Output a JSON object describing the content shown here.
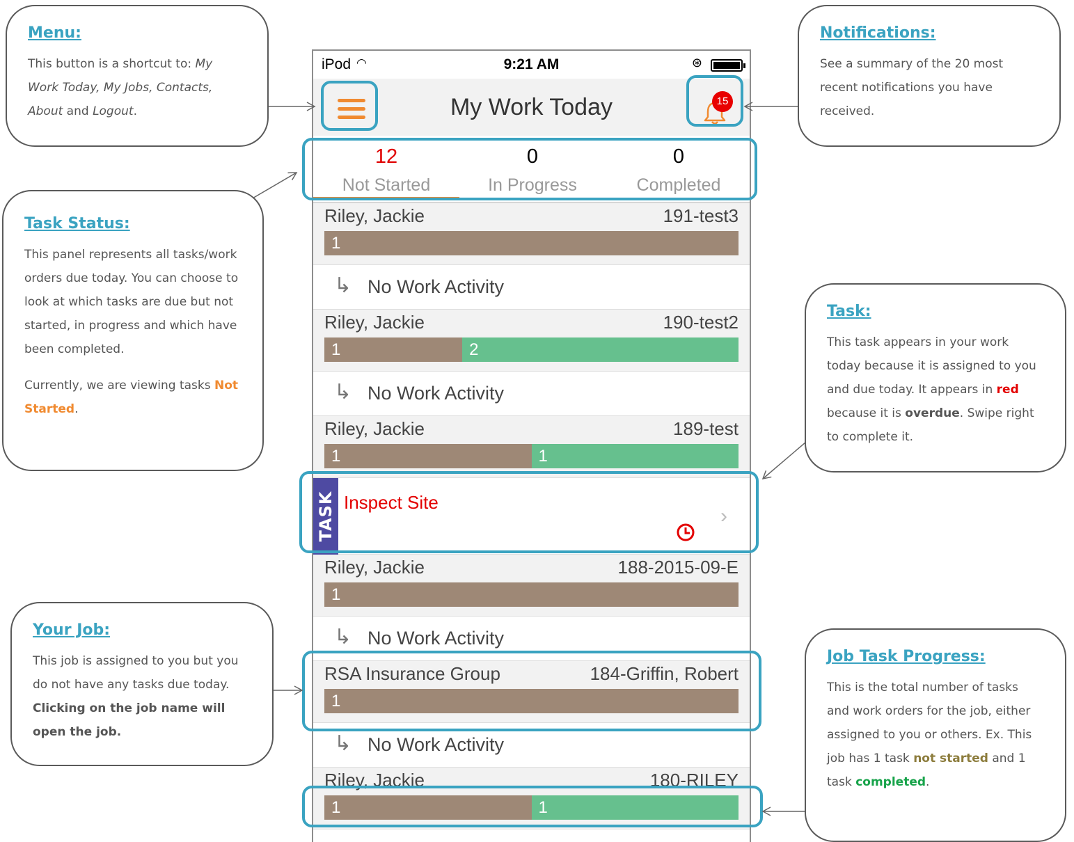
{
  "phone": {
    "status_bar": {
      "carrier": "iPod",
      "time": "9:21 AM"
    },
    "nav": {
      "title": "My Work Today",
      "notification_count": "15"
    },
    "tabs": [
      {
        "count": "12",
        "label": "Not Started"
      },
      {
        "count": "0",
        "label": "In Progress"
      },
      {
        "count": "0",
        "label": "Completed"
      }
    ],
    "rows": {
      "job1": {
        "name": "Riley, Jackie",
        "ref": "191-test3",
        "seg1": "1"
      },
      "activity1": "No Work Activity",
      "job2": {
        "name": "Riley, Jackie",
        "ref": "190-test2",
        "seg1": "1",
        "seg2": "2"
      },
      "activity2": "No Work Activity",
      "job3": {
        "name": "Riley, Jackie",
        "ref": "189-test",
        "seg1": "1",
        "seg2": "1"
      },
      "task": {
        "side_label": "TASK",
        "name": "Inspect Site"
      },
      "job4": {
        "name": "Riley, Jackie",
        "ref": "188-2015-09-E",
        "seg1": "1"
      },
      "activity3": "No Work Activity",
      "job5": {
        "name": "RSA Insurance Group",
        "ref": "184-Griffin, Robert",
        "seg1": "1"
      },
      "activity4": "No Work Activity",
      "job6": {
        "name": "Riley, Jackie",
        "ref": "180-RILEY",
        "seg1": "1",
        "seg2": "1"
      }
    }
  },
  "callouts": {
    "menu": {
      "title": "Menu:",
      "t1": "This button is a shortcut to: ",
      "t2": "My Work Today, My Jobs, Contacts, About",
      "t3": " and ",
      "t4": "Logout",
      "t5": "."
    },
    "notifications": {
      "title": "Notifications:",
      "text": "See a summary of the 20 most recent notifications you have received."
    },
    "task_status": {
      "title": "Task Status:",
      "p1": "This panel represents all tasks/work orders due today. You can choose to look at which tasks are due but not started, in progress and which have been completed.",
      "p2a": "Currently, we are viewing tasks ",
      "p2b": "Not Started",
      "p2c": "."
    },
    "task": {
      "title": "Task:",
      "t1": "This task appears in your work today because it is assigned to you and due today.  It appears in ",
      "t2": "red",
      "t3": " because it is ",
      "t4": "overdue",
      "t5": ".  Swipe right to complete it."
    },
    "your_job": {
      "title": "Your Job:",
      "t1": "This job is assigned to you but you do not have any tasks due today.  ",
      "t2": "Clicking on the job name will open the job."
    },
    "job_progress": {
      "title": "Job Task Progress:",
      "t1": "This is the total number of tasks and work orders for the job, either assigned to you or others.  Ex. This job has 1 task ",
      "t2": "not started",
      "t3": " and 1 task ",
      "t4": "completed",
      "t5": "."
    }
  },
  "colors": {
    "accent_blue": "#3aa3c1",
    "orange": "#f08a30",
    "overdue_red": "#e30000",
    "bar_brown": "#9e8876",
    "bar_green": "#66c08e",
    "task_purple": "#4e4aa2"
  },
  "icons": [
    "hamburger-menu-icon",
    "bell-icon",
    "wifi-icon",
    "battery-icon",
    "return-arrow-icon",
    "clock-icon",
    "chevron-right-icon"
  ]
}
